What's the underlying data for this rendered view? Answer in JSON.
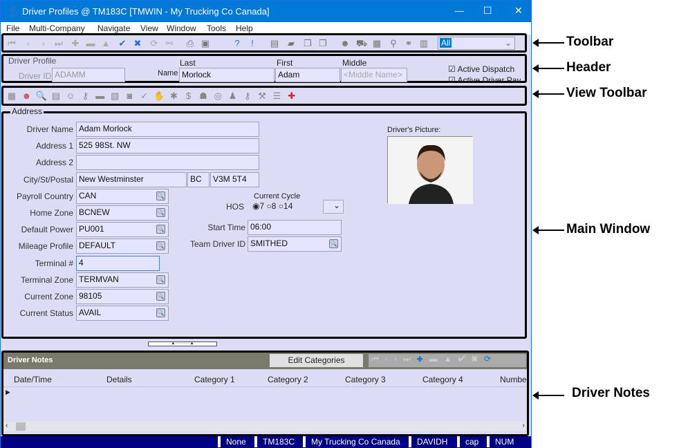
{
  "window": {
    "title": "Driver Profiles @ TM183C [TMWIN - My Trucking Co Canada]",
    "minimize": "—",
    "maximize": "☐",
    "close": "✕"
  },
  "menu": [
    "File",
    "Multi-Company",
    "Navigate",
    "View",
    "Window",
    "Tools",
    "Help"
  ],
  "toolbar": {
    "icons": [
      "first-icon",
      "previous-icon",
      "next-icon",
      "last-icon",
      "add-icon",
      "delete-icon",
      "up-icon",
      "save-check-icon",
      "cancel-x-icon",
      "refresh-icon",
      "link-icon",
      "print-icon",
      "monitor-icon",
      "help-icon",
      "info-icon",
      "document-icon",
      "book-icon",
      "copy-icon",
      "copy2-icon",
      "driver-icon",
      "truck-icon",
      "map-icon",
      "tools-icon",
      "chain-icon",
      "trailer-icon"
    ],
    "filter_value": "All"
  },
  "header": {
    "section": "Driver Profile",
    "driver_id_label": "Driver ID",
    "driver_id": "ADAMM",
    "name_label": "Name",
    "last_label": "Last",
    "first_label": "First",
    "middle_label": "Middle",
    "last": "Morlock",
    "first": "Adam",
    "middle_placeholder": "<Middle Name>",
    "active_dispatch": "Active Dispatch",
    "active_driver_pay": "Active Driver Pay"
  },
  "view_toolbar": {
    "icons": [
      "grid-icon",
      "driver-icon",
      "search-icon",
      "notes-icon",
      "doctor-icon",
      "keys-icon",
      "card-icon",
      "calendar-icon",
      "database-icon",
      "document-check-icon",
      "handshake-icon",
      "network-icon",
      "money-bag-icon",
      "lock-person-icon",
      "coins-icon",
      "police-icon",
      "key-icon",
      "wrench-icon",
      "list-icon",
      "medical-icon"
    ]
  },
  "main": {
    "group_label": "Address",
    "fields": [
      {
        "label": "Driver Name",
        "value": "Adam  Morlock"
      },
      {
        "label": "Address 1",
        "value": "525 98St. NW"
      },
      {
        "label": "Address 2",
        "value": ""
      },
      {
        "label": "City/St/Postal",
        "value": "New Westminster",
        "state": "BC",
        "postal": "V3M 5T4"
      },
      {
        "label": "Payroll Country",
        "value": "CAN"
      },
      {
        "label": "Home Zone",
        "value": "BCNEW"
      },
      {
        "label": "Default Power",
        "value": "PU001"
      },
      {
        "label": "Mileage Profile",
        "value": "DEFAULT"
      },
      {
        "label": "Terminal #",
        "value": "4"
      },
      {
        "label": "Terminal Zone",
        "value": "TERMVAN"
      },
      {
        "label": "Current Zone",
        "value": "98105"
      },
      {
        "label": "Current Status",
        "value": "AVAIL"
      }
    ],
    "hos_label": "HOS",
    "current_cycle_label": "Current Cycle",
    "cycles": [
      "7",
      "8",
      "14"
    ],
    "selected_cycle": "7",
    "start_time_label": "Start Time",
    "start_time": "06:00",
    "team_driver_label": "Team Driver ID",
    "team_driver": "SMITHED",
    "picture_label": "Driver's Picture:"
  },
  "notes": {
    "title": "Driver Notes",
    "edit_categories": "Edit Categories",
    "columns": [
      "Date/Time",
      "Details",
      "Category 1",
      "Category 2",
      "Category 3",
      "Category 4",
      "Numbe"
    ]
  },
  "status": [
    "None",
    "TM183C",
    "My Trucking Co Canada",
    "DAVIDH",
    "cap",
    "NUM"
  ],
  "annotations": [
    "Toolbar",
    "Header",
    "View Toolbar",
    "Main Window",
    "Driver Notes"
  ]
}
